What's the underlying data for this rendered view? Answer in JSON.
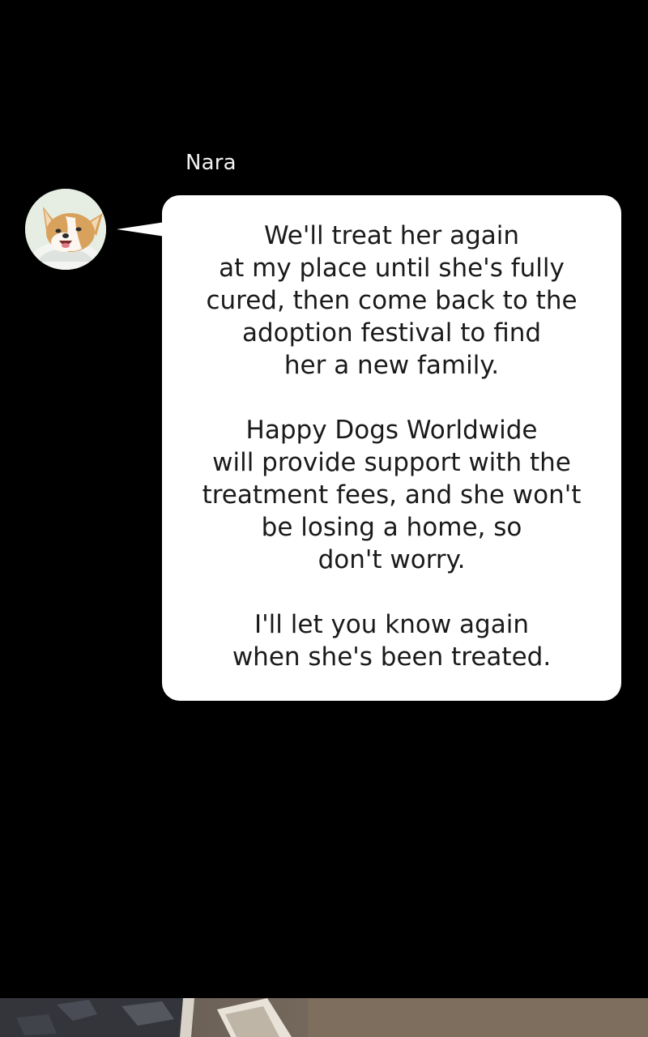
{
  "chat": {
    "sender_name": "Nara",
    "avatar": "corgi-avatar",
    "message_paragraphs": [
      "We'll treat her again\nat my place until she's fully\ncured, then come back to the\nadoption festival to find\nher a new family.",
      "Happy Dogs Worldwide\nwill provide support with the\ntreatment fees, and she won't\nbe losing a home, so\ndon't worry.",
      "I'll let you know again\nwhen she's been treated."
    ]
  },
  "colors": {
    "background": "#000000",
    "bubble": "#ffffff",
    "text": "#1a1a1a",
    "name_text": "#f2f2f2"
  }
}
